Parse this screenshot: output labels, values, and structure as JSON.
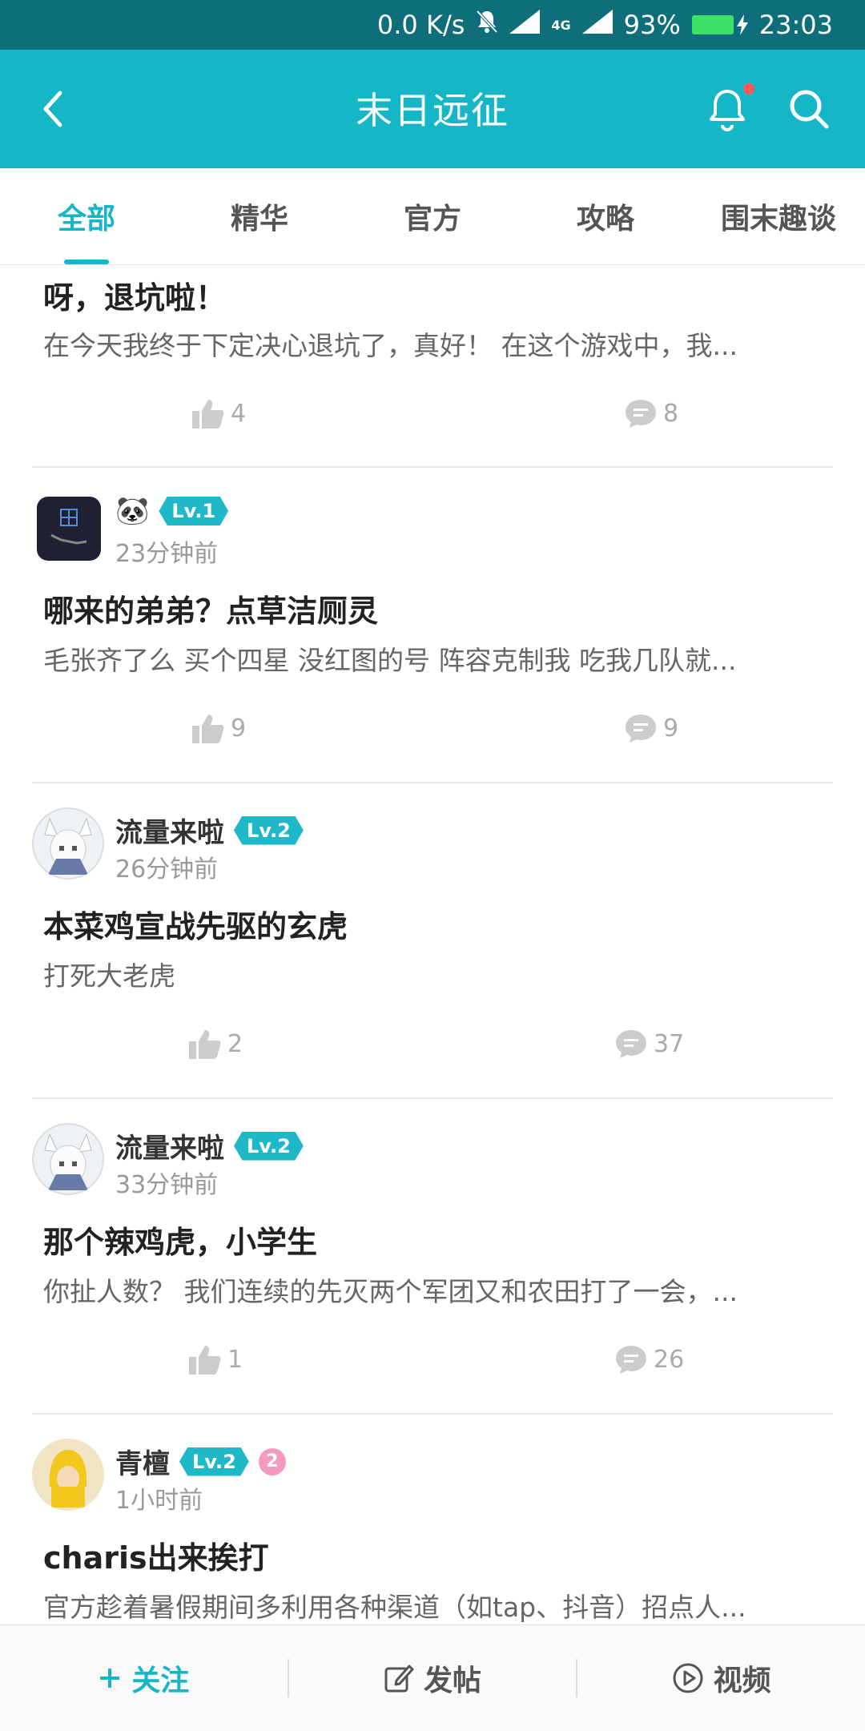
{
  "status_bar": {
    "net_speed": "0.0 K/s",
    "signal_label": "4G",
    "battery": "93%",
    "time": "23:03"
  },
  "app_bar": {
    "title": "末日远征",
    "accent_color": "#15b7c6"
  },
  "tabs": [
    {
      "label": "全部",
      "active": true
    },
    {
      "label": "精华",
      "active": false
    },
    {
      "label": "官方",
      "active": false
    },
    {
      "label": "攻略",
      "active": false
    },
    {
      "label": "围末趣谈",
      "active": false
    }
  ],
  "posts": [
    {
      "title": "呀，退坑啦！",
      "body": "在今天我终于下定决心退坑了，真好！ 在这个游戏中，我...",
      "likes": "4",
      "comments": "8"
    },
    {
      "author": "🐼",
      "level": "Lv.1",
      "time": "23分钟前",
      "title": "哪来的弟弟？点草洁厕灵",
      "body": "毛张齐了么  买个四星 没红图的号  阵容克制我 吃我几队就...",
      "likes": "9",
      "comments": "9"
    },
    {
      "author": "流量来啦",
      "level": "Lv.2",
      "time": "26分钟前",
      "title": "本菜鸡宣战先驱的玄虎",
      "body": "打死大老虎",
      "likes": "2",
      "comments": "37"
    },
    {
      "author": "流量来啦",
      "level": "Lv.2",
      "time": "33分钟前",
      "title": "那个辣鸡虎，小学生",
      "body": "你扯人数？ 我们连续的先灭两个军团又和农田打了一会，...",
      "likes": "1",
      "comments": "26"
    },
    {
      "author": "青檀",
      "level": "Lv.2",
      "medal": "2",
      "time": "1小时前",
      "title": "charis出来挨打",
      "body": "官方趁着暑假期间多利用各种渠道（如tap、抖音）招点人..."
    }
  ],
  "bottom_bar": {
    "follow": "关注",
    "post": "发帖",
    "video": "视频"
  }
}
